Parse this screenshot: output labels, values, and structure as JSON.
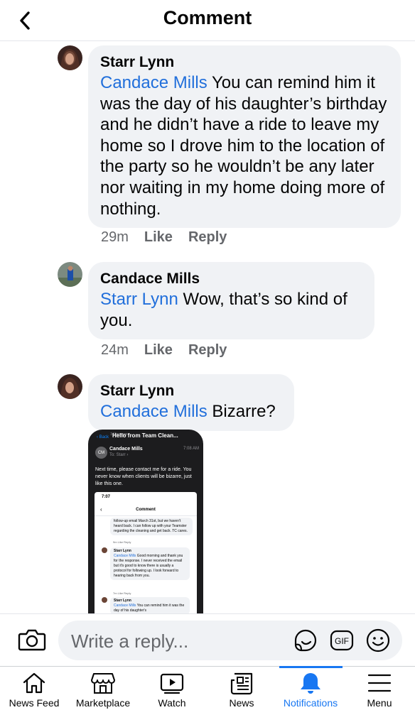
{
  "header": {
    "title": "Comment"
  },
  "comments": [
    {
      "author": "Starr Lynn",
      "mention": "Candace Mills",
      "text": " You can remind him it was the day of his daughter’s birthday and he didn’t have a ride to leave my home so I drove him to the location of the party so he wouldn’t be any later nor waiting in my home doing more of nothing.",
      "time": "29m",
      "like": "Like",
      "reply": "Reply"
    },
    {
      "author": "Candace Mills",
      "mention": "Starr Lynn",
      "text": " Wow, that’s so kind of you.",
      "time": "24m",
      "like": "Like",
      "reply": "Reply"
    },
    {
      "author": "Starr Lynn",
      "mention": "Candace Mills",
      "text": " Bizarre?"
    }
  ],
  "attachment": {
    "back": "‹ Back",
    "messages_count": "3 Messages",
    "subject": "Hello from Team Clean...",
    "initials": "CM",
    "from": "Candace Mills",
    "to": "To: Starr ›",
    "time": "7:08 AM",
    "body": "Next time, please contact me for a ride. You never know when clients will be bizarre, just like this one.",
    "inner": {
      "status_time": "7:07",
      "title": "Comment",
      "top_text": "follow-up email March 31st, but we haven't heard back. I can follow up with your Teamster regarding the cleaning and get back. TC cares.",
      "top_meta": "9m  Like  Reply",
      "c1_author": "Starr Lynn",
      "c1_mention": "Candace Mills",
      "c1_text": " Good morning and thank you for the response. I never received the email but it's good to know there is usually a protocol for following up. I look forward to hearing back from you.",
      "c1_meta": "7m  Like  Reply",
      "c2_author": "Starr Lynn",
      "c2_mention": "Candace Mills",
      "c2_text": " You can remind him it was the day of his daughter's"
    }
  },
  "composer": {
    "placeholder": "Write a reply..."
  },
  "tabs": [
    {
      "label": "News Feed",
      "icon": "home-icon"
    },
    {
      "label": "Marketplace",
      "icon": "marketplace-icon"
    },
    {
      "label": "Watch",
      "icon": "watch-icon"
    },
    {
      "label": "News",
      "icon": "news-icon"
    },
    {
      "label": "Notifications",
      "icon": "bell-icon",
      "active": true
    },
    {
      "label": "Menu",
      "icon": "menu-icon"
    }
  ],
  "colors": {
    "accent": "#1877f2",
    "mention": "#216fdb",
    "bubble": "#f0f2f5",
    "meta": "#65676b"
  }
}
